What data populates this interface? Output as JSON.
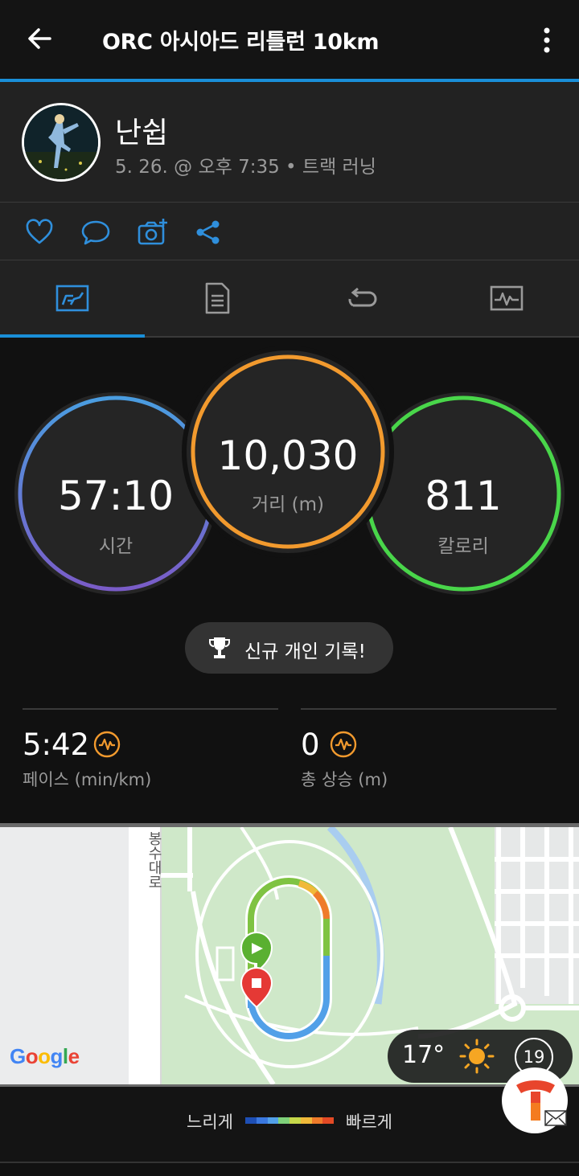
{
  "header": {
    "title": "ORC 아시아드 리틀런 10km"
  },
  "profile": {
    "name": "난쉽",
    "meta": "5. 26. @ 오후 7:35 • 트랙 러닝"
  },
  "actions": [
    "heart-icon",
    "comment-icon",
    "add-photo-icon",
    "share-icon"
  ],
  "tabs": [
    {
      "name": "overview",
      "icon": "overview-icon",
      "active": true
    },
    {
      "name": "details",
      "icon": "document-icon",
      "active": false
    },
    {
      "name": "laps",
      "icon": "laps-icon",
      "active": false
    },
    {
      "name": "charts",
      "icon": "chart-icon",
      "active": false
    }
  ],
  "stats": {
    "time": {
      "value": "57:10",
      "label": "시간",
      "color": "#4a8fd6"
    },
    "distance": {
      "value": "10,030",
      "label": "거리 (m)",
      "color": "#f29a2e"
    },
    "calories": {
      "value": "811",
      "label": "칼로리",
      "color": "#49d64a"
    }
  },
  "record_badge": "신규 개인 기록!",
  "metrics": {
    "pace": {
      "value": "5:42",
      "label": "페이스 (min/km)"
    },
    "elevation": {
      "value": "0",
      "label": "총 상승 (m)"
    }
  },
  "map": {
    "road_label": "봉수대로",
    "attribution": "Google",
    "weather": {
      "temperature": "17°",
      "aqi": "19"
    }
  },
  "legend": {
    "slow": "느리게",
    "fast": "빠르게",
    "colors": [
      "#1e4fb5",
      "#3a78e0",
      "#52a0e8",
      "#7fd17a",
      "#c6d84a",
      "#f0b93a",
      "#ef7b2a",
      "#e34a25"
    ]
  },
  "colors": {
    "accent": "#1a8fd8",
    "background": "#111111",
    "panel": "#222222"
  }
}
